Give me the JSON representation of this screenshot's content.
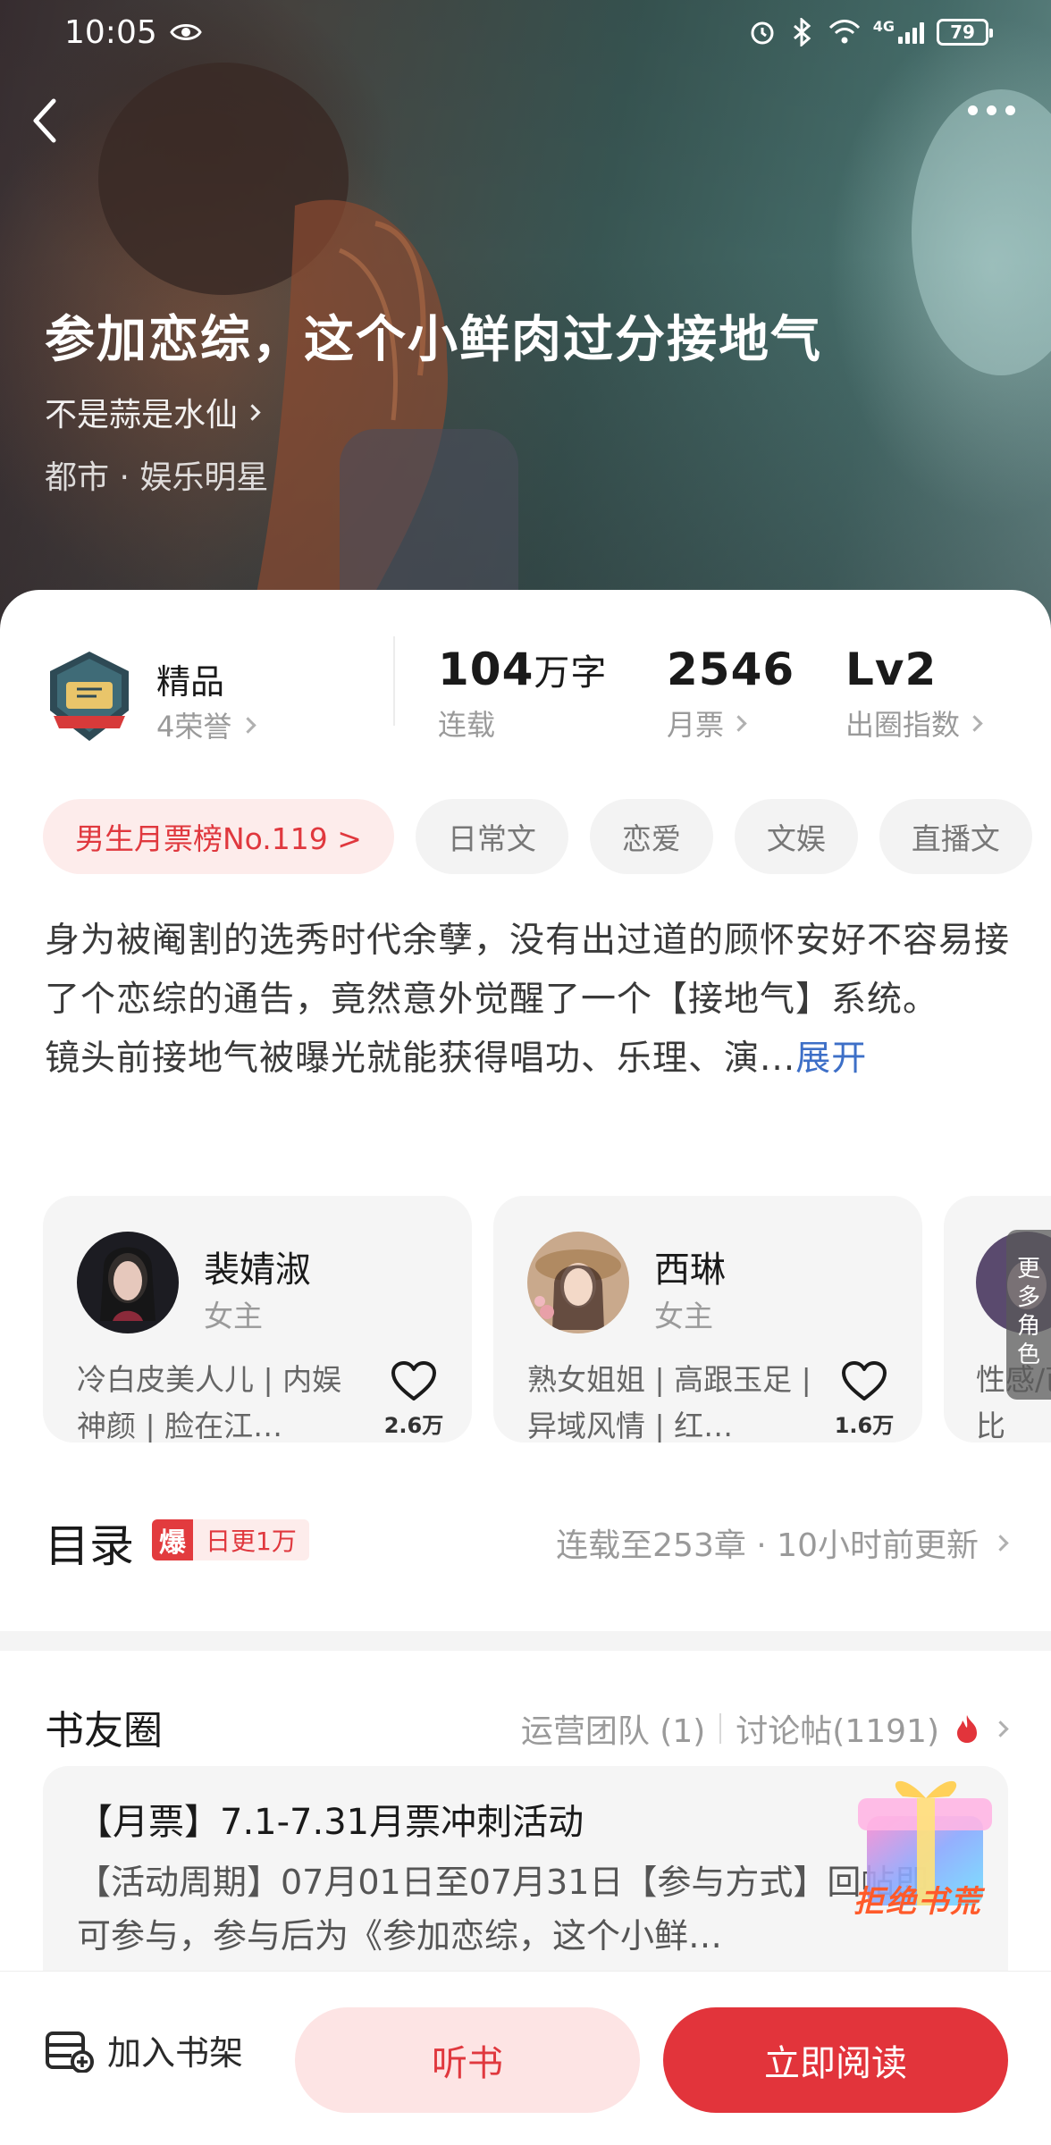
{
  "status_bar": {
    "time": "10:05",
    "network": "4G",
    "battery": "79"
  },
  "book": {
    "title": "参加恋综，这个小鲜肉过分接地气",
    "author": "不是蒜是水仙",
    "genre": "都市 · 娱乐明星"
  },
  "stats": {
    "honor_title": "精品",
    "honor_sub": "4荣誉",
    "word_count_num": "104",
    "word_count_unit": "万字",
    "word_count_label": "连载",
    "monthly_votes": "2546",
    "monthly_votes_label": "月票",
    "level": "Lv2",
    "level_label": "出圈指数"
  },
  "tags": [
    "男生月票榜No.119 >",
    "日常文",
    "恋爱",
    "文娱",
    "直播文"
  ],
  "synopsis": {
    "text": "身为被阉割的选秀时代余孽，没有出过道的顾怀安好不容易接了个恋综的通告，竟然意外觉醒了一个【接地气】系统。\n镜头前接地气被曝光就能获得唱功、乐理、演...",
    "expand": "展开"
  },
  "characters": [
    {
      "name": "裴婧淑",
      "role": "女主",
      "desc": "冷白皮美人儿 | 内娱神颜 | 脸在江…",
      "likes": "2.6万"
    },
    {
      "name": "西琳",
      "role": "女主",
      "desc": "熟女姐姐 | 高跟玉足 | 异域风情 | 红…",
      "likes": "1.6万"
    },
    {
      "name": "",
      "role": "",
      "desc": "性感/芭比",
      "likes": ""
    }
  ],
  "more_roles": "更多角色",
  "catalog": {
    "title": "目录",
    "badge_icon": "爆",
    "badge_text": "日更1万",
    "status": "连载至253章 · 10小时前更新"
  },
  "friends": {
    "title": "书友圈",
    "team": "运营团队 (1)",
    "posts": "讨论帖(1191)",
    "post_title": "【月票】7.1-7.31月票冲刺活动",
    "post_body": "【活动周期】07月01日至07月31日【参与方式】回帖即可参与，参与后为《参加恋综，这个小鲜…",
    "promo": "拒绝书荒"
  },
  "bottom": {
    "shelf": "加入书架",
    "listen": "听书",
    "read": "立即阅读"
  },
  "colors": {
    "accent_red": "#e2343b",
    "link_blue": "#3d6fc7",
    "tag_bg": "#f3f3f3"
  }
}
